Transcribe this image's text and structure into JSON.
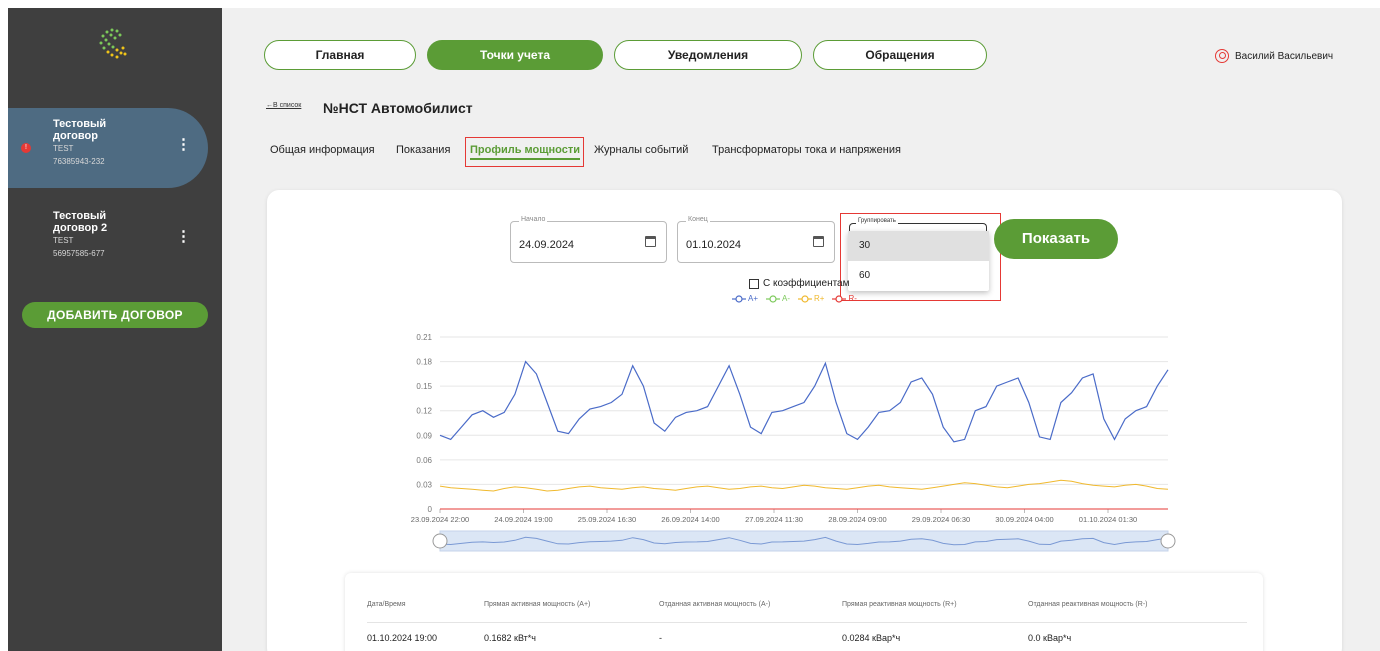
{
  "sidebar": {
    "contracts": [
      {
        "name": "Тестовый договор",
        "code": "TEST",
        "number": "76385943-232",
        "badge": "!"
      },
      {
        "name": "Тестовый договор 2",
        "code": "TEST",
        "number": "56957585-677",
        "badge": ""
      }
    ],
    "menu_icon": "⋮",
    "add_button": "ДОБАВИТЬ ДОГОВОР"
  },
  "header": {
    "nav": [
      "Главная",
      "Точки учета",
      "Уведомления",
      "Обращения"
    ],
    "active_nav": "Точки учета",
    "user_name": "Василий Васильевич"
  },
  "page": {
    "back_link": "←В список",
    "title": "№НСТ Автомобилист",
    "tabs": [
      "Общая информация",
      "Показания",
      "Профиль мощности",
      "Журналы событий",
      "Трансформаторы тока и напряжения"
    ],
    "active_tab": "Профиль мощности"
  },
  "filters": {
    "start_label": "Начало",
    "start_value": "24.09.2024",
    "end_label": "Конец",
    "end_value": "01.10.2024",
    "group_label": "Группировать",
    "group_options": [
      "30",
      "60"
    ],
    "group_highlighted": "30",
    "show_button": "Показать",
    "coefficient_label": "С коэффициентам"
  },
  "colors": {
    "brand_green": "#5b9c36",
    "sidebar_bg": "#3f3f3f",
    "active_contract": "#4e6b82",
    "a_plus": "#4a6bc8",
    "a_minus": "#7cc95a",
    "r_plus": "#f0b92e",
    "r_minus": "#e53935",
    "highlight": "#e53935"
  },
  "chart_data": {
    "type": "line",
    "legend": [
      "A+",
      "A-",
      "R+",
      "R-"
    ],
    "y_ticks": [
      "0",
      "0.03",
      "0.06",
      "0.09",
      "0.12",
      "0.15",
      "0.18",
      "0.21"
    ],
    "ylim": [
      0,
      0.21
    ],
    "x_ticks": [
      "23.09.2024 22:00",
      "24.09.2024 19:00",
      "25.09.2024 16:30",
      "26.09.2024 14:00",
      "27.09.2024 11:30",
      "28.09.2024 09:00",
      "29.09.2024 06:30",
      "30.09.2024 04:00",
      "01.10.2024 01:30"
    ],
    "series": [
      {
        "name": "A+",
        "values": [
          0.09,
          0.085,
          0.1,
          0.115,
          0.12,
          0.112,
          0.118,
          0.14,
          0.18,
          0.165,
          0.13,
          0.095,
          0.092,
          0.11,
          0.122,
          0.125,
          0.13,
          0.14,
          0.175,
          0.15,
          0.105,
          0.095,
          0.112,
          0.118,
          0.12,
          0.125,
          0.15,
          0.175,
          0.14,
          0.1,
          0.092,
          0.118,
          0.12,
          0.125,
          0.13,
          0.15,
          0.178,
          0.13,
          0.092,
          0.085,
          0.1,
          0.118,
          0.12,
          0.13,
          0.155,
          0.16,
          0.14,
          0.1,
          0.082,
          0.085,
          0.12,
          0.125,
          0.15,
          0.155,
          0.16,
          0.13,
          0.088,
          0.085,
          0.13,
          0.142,
          0.16,
          0.165,
          0.11,
          0.085,
          0.11,
          0.12,
          0.125,
          0.15,
          0.17
        ]
      },
      {
        "name": "A-",
        "values": [
          0,
          0,
          0,
          0,
          0,
          0,
          0,
          0,
          0,
          0,
          0,
          0,
          0,
          0,
          0,
          0,
          0,
          0,
          0,
          0,
          0,
          0,
          0,
          0,
          0,
          0,
          0,
          0,
          0,
          0,
          0,
          0,
          0,
          0,
          0,
          0,
          0,
          0,
          0,
          0,
          0,
          0,
          0,
          0,
          0,
          0,
          0,
          0,
          0,
          0,
          0,
          0,
          0,
          0,
          0,
          0,
          0,
          0,
          0,
          0,
          0,
          0,
          0,
          0,
          0,
          0,
          0,
          0,
          0
        ]
      },
      {
        "name": "R+",
        "values": [
          0.028,
          0.026,
          0.025,
          0.024,
          0.023,
          0.022,
          0.025,
          0.027,
          0.026,
          0.024,
          0.022,
          0.023,
          0.025,
          0.027,
          0.028,
          0.026,
          0.025,
          0.024,
          0.026,
          0.027,
          0.025,
          0.024,
          0.023,
          0.025,
          0.027,
          0.028,
          0.026,
          0.024,
          0.025,
          0.027,
          0.028,
          0.026,
          0.025,
          0.027,
          0.029,
          0.028,
          0.026,
          0.025,
          0.024,
          0.026,
          0.028,
          0.029,
          0.027,
          0.026,
          0.025,
          0.024,
          0.026,
          0.028,
          0.03,
          0.032,
          0.031,
          0.029,
          0.027,
          0.026,
          0.028,
          0.03,
          0.031,
          0.033,
          0.035,
          0.034,
          0.031,
          0.029,
          0.028,
          0.027,
          0.029,
          0.03,
          0.028,
          0.025,
          0.024
        ]
      },
      {
        "name": "R-",
        "values": [
          0,
          0,
          0,
          0,
          0,
          0,
          0,
          0,
          0,
          0,
          0,
          0,
          0,
          0,
          0,
          0,
          0,
          0,
          0,
          0,
          0,
          0,
          0,
          0,
          0,
          0,
          0,
          0,
          0,
          0,
          0,
          0,
          0,
          0,
          0,
          0,
          0,
          0,
          0,
          0,
          0,
          0,
          0,
          0,
          0,
          0,
          0,
          0,
          0,
          0,
          0,
          0,
          0,
          0,
          0,
          0,
          0,
          0,
          0,
          0,
          0,
          0,
          0,
          0,
          0,
          0,
          0,
          0,
          0
        ]
      }
    ]
  },
  "table": {
    "headers": [
      "Дата/Время",
      "Прямая активная мощность (A+)",
      "Отданная активная мощность (A-)",
      "Прямая реактивная мощность (R+)",
      "Отданная реактивная мощность (R-)"
    ],
    "rows": [
      [
        "01.10.2024 19:00",
        "0.1682 кВт*ч",
        "-",
        "0.0284 кВар*ч",
        "0.0 кВар*ч"
      ]
    ]
  }
}
